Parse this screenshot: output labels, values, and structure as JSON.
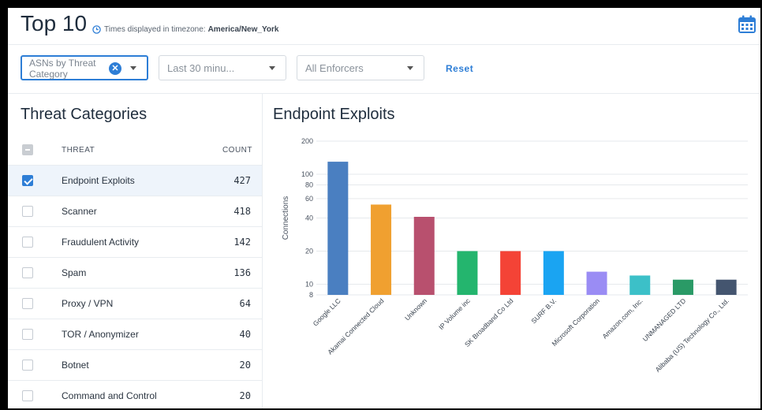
{
  "header": {
    "title": "Top 10",
    "timezone_label": "Times displayed in timezone:",
    "timezone": "America/New_York"
  },
  "filters": {
    "category": "ASNs by Threat Category",
    "time_range": "Last 30 minu...",
    "enforcers": "All Enforcers",
    "reset": "Reset"
  },
  "left_panel": {
    "title": "Threat Categories",
    "col_threat": "THREAT",
    "col_count": "COUNT",
    "rows": [
      {
        "name": "Endpoint Exploits",
        "count": "427",
        "checked": true
      },
      {
        "name": "Scanner",
        "count": "418",
        "checked": false
      },
      {
        "name": "Fraudulent Activity",
        "count": "142",
        "checked": false
      },
      {
        "name": "Spam",
        "count": "136",
        "checked": false
      },
      {
        "name": "Proxy / VPN",
        "count": "64",
        "checked": false
      },
      {
        "name": "TOR / Anonymizer",
        "count": "40",
        "checked": false
      },
      {
        "name": "Botnet",
        "count": "20",
        "checked": false
      },
      {
        "name": "Command and Control",
        "count": "20",
        "checked": false
      }
    ]
  },
  "chart_data": {
    "type": "bar",
    "title": "Endpoint Exploits",
    "ylabel": "Connections",
    "y_scale": "log",
    "ylim": [
      8,
      200
    ],
    "yticks": [
      8,
      10,
      20,
      40,
      60,
      80,
      100,
      200
    ],
    "categories": [
      "Google LLC",
      "Akamai Connected Cloud",
      "Unknown",
      "IP Volume inc",
      "SK Broadband Co Ltd",
      "SURF B.V.",
      "Microsoft Corporation",
      "Amazon.com, Inc.",
      "UNMANAGED LTD",
      "Alibaba (US) Technology Co., Ltd."
    ],
    "values": [
      130,
      53,
      41,
      20,
      20,
      20,
      13,
      12,
      11,
      11
    ],
    "colors": [
      "#4a7fc1",
      "#f0a030",
      "#b8506e",
      "#24b56e",
      "#f44336",
      "#1aa4f2",
      "#9a8cf4",
      "#3cc0c8",
      "#2a9a66",
      "#44556f"
    ]
  }
}
